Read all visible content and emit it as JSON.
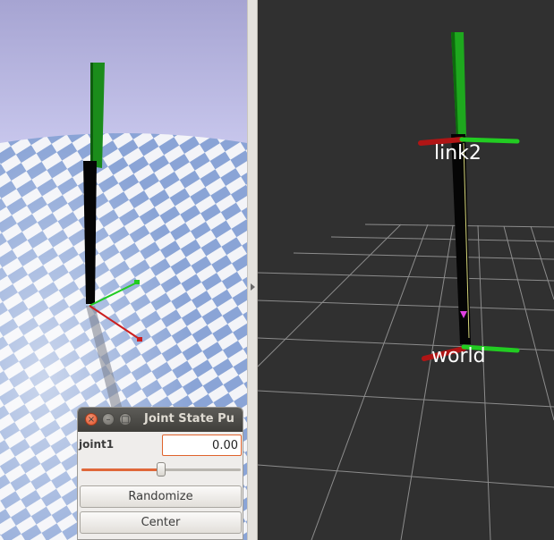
{
  "rviz": {
    "frame_labels": [
      "link2",
      "world"
    ]
  },
  "joint_state_publisher": {
    "title": "Joint State Pu",
    "joints": [
      {
        "name": "joint1",
        "value": "0.00",
        "slider_fraction": 0.5
      }
    ],
    "randomize_label": "Randomize",
    "center_label": "Center"
  },
  "colors": {
    "accent": "#e0632c",
    "rviz_background": "#2f2f2f",
    "sim_sky": "#a9a7d4",
    "floor_blue": "#8ca6d8"
  }
}
